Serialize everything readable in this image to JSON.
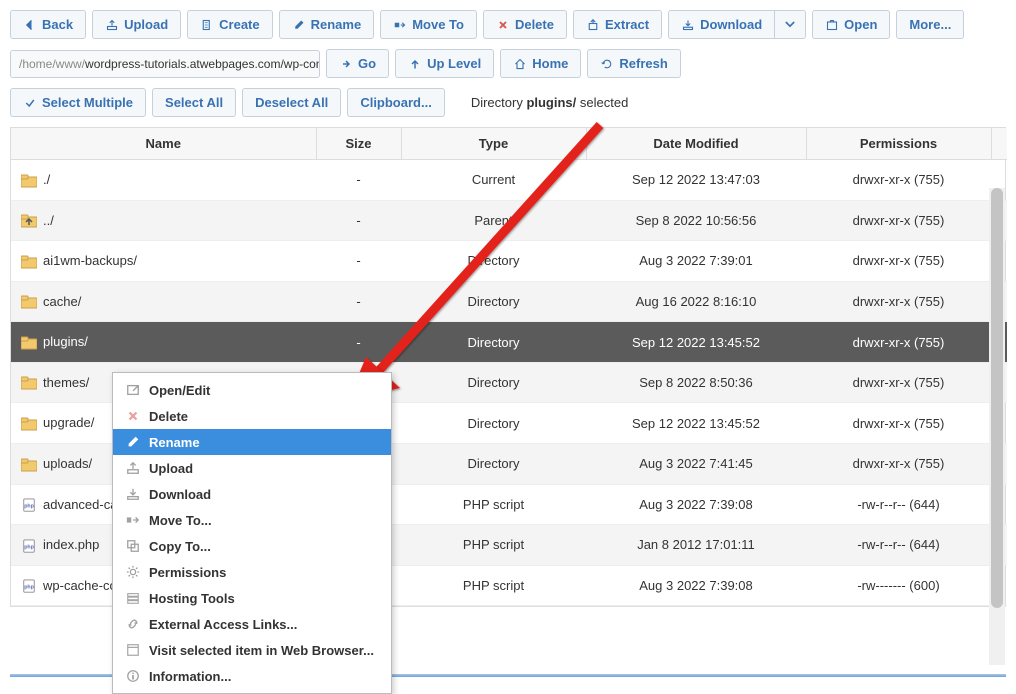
{
  "toolbar": {
    "back": "Back",
    "upload": "Upload",
    "create": "Create",
    "rename": "Rename",
    "move_to": "Move To",
    "delete": "Delete",
    "extract": "Extract",
    "download": "Download",
    "open": "Open",
    "more": "More..."
  },
  "path": {
    "visible": "/home/www/",
    "rest": "wordpress-tutorials.atwebpages.com/wp-con",
    "go": "Go",
    "up_level": "Up Level",
    "home": "Home",
    "refresh": "Refresh"
  },
  "select": {
    "multiple": "Select Multiple",
    "all": "Select All",
    "deselect": "Deselect All",
    "clipboard": "Clipboard..."
  },
  "status": {
    "prefix": "Directory ",
    "selected": "plugins/",
    "suffix": " selected"
  },
  "columns": {
    "name": "Name",
    "size": "Size",
    "type": "Type",
    "modified": "Date Modified",
    "permissions": "Permissions"
  },
  "rows": [
    {
      "name": "./",
      "size": "-",
      "type": "Current",
      "modified": "Sep 12 2022 13:47:03",
      "perms": "drwxr-xr-x (755)",
      "icon": "folder"
    },
    {
      "name": "../",
      "size": "-",
      "type": "Parent",
      "modified": "Sep 8 2022 10:56:56",
      "perms": "drwxr-xr-x (755)",
      "icon": "up"
    },
    {
      "name": "ai1wm-backups/",
      "size": "-",
      "type": "Directory",
      "modified": "Aug 3 2022 7:39:01",
      "perms": "drwxr-xr-x (755)",
      "icon": "folder"
    },
    {
      "name": "cache/",
      "size": "-",
      "type": "Directory",
      "modified": "Aug 16 2022 8:16:10",
      "perms": "drwxr-xr-x (755)",
      "icon": "folder"
    },
    {
      "name": "plugins/",
      "size": "-",
      "type": "Directory",
      "modified": "Sep 12 2022 13:45:52",
      "perms": "drwxr-xr-x (755)",
      "icon": "folder",
      "selected": true
    },
    {
      "name": "themes/",
      "size": "-",
      "type": "Directory",
      "modified": "Sep 8 2022 8:50:36",
      "perms": "drwxr-xr-x (755)",
      "icon": "folder"
    },
    {
      "name": "upgrade/",
      "size": "-",
      "type": "Directory",
      "modified": "Sep 12 2022 13:45:52",
      "perms": "drwxr-xr-x (755)",
      "icon": "folder"
    },
    {
      "name": "uploads/",
      "size": "-",
      "type": "Directory",
      "modified": "Aug 3 2022 7:41:45",
      "perms": "drwxr-xr-x (755)",
      "icon": "folder"
    },
    {
      "name": "advanced-ca",
      "size": "",
      "type": "PHP script",
      "modified": "Aug 3 2022 7:39:08",
      "perms": "-rw-r--r-- (644)",
      "icon": "php"
    },
    {
      "name": "index.php",
      "size": "",
      "type": "PHP script",
      "modified": "Jan 8 2012 17:01:11",
      "perms": "-rw-r--r-- (644)",
      "icon": "php"
    },
    {
      "name": "wp-cache-co",
      "size": "",
      "type": "PHP script",
      "modified": "Aug 3 2022 7:39:08",
      "perms": "-rw------- (600)",
      "icon": "php"
    }
  ],
  "context_menu": [
    {
      "label": "Open/Edit",
      "icon": "open"
    },
    {
      "label": "Delete",
      "icon": "delete"
    },
    {
      "label": "Rename",
      "icon": "rename",
      "highlighted": true
    },
    {
      "label": "Upload",
      "icon": "upload"
    },
    {
      "label": "Download",
      "icon": "download"
    },
    {
      "label": "Move To...",
      "icon": "move"
    },
    {
      "label": "Copy To...",
      "icon": "copy"
    },
    {
      "label": "Permissions",
      "icon": "gear"
    },
    {
      "label": "Hosting Tools",
      "icon": "hosting"
    },
    {
      "label": "External Access Links...",
      "icon": "link"
    },
    {
      "label": "Visit selected item in Web Browser...",
      "icon": "browser"
    },
    {
      "label": "Information...",
      "icon": "info"
    }
  ]
}
